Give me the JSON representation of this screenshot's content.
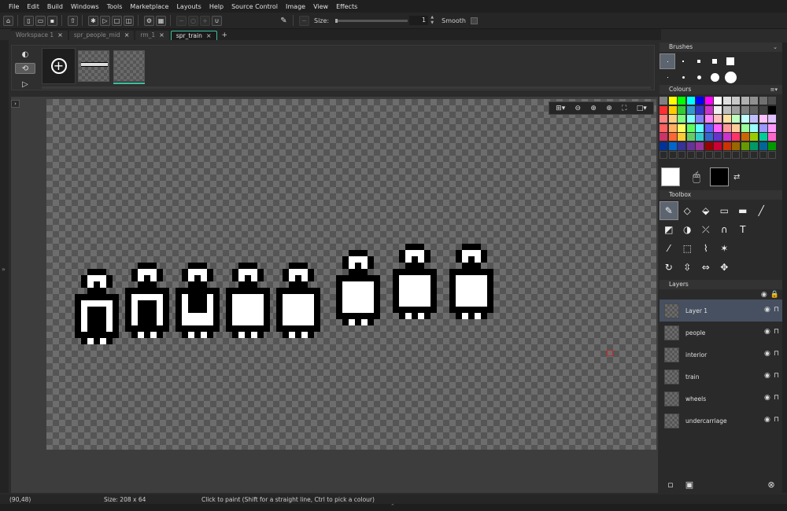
{
  "menu": [
    "File",
    "Edit",
    "Build",
    "Windows",
    "Tools",
    "Marketplace",
    "Layouts",
    "Help",
    "Source Control",
    "Image",
    "View",
    "Effects"
  ],
  "toolbar": {
    "size_label": "Size:",
    "size_value": "1",
    "size_fraction": 0.0,
    "smooth_label": "Smooth",
    "smooth_checked": false
  },
  "tabs": [
    {
      "label": "Workspace 1",
      "active": false
    },
    {
      "label": "spr_people_mid",
      "active": false
    },
    {
      "label": "rm_1",
      "active": false
    },
    {
      "label": "spr_train",
      "active": true
    }
  ],
  "frames": {
    "count": 2,
    "selected_index": 1
  },
  "panels": {
    "brushes_title": "Brushes",
    "colours_title": "Colours",
    "toolbox_title": "Toolbox",
    "layers_title": "Layers"
  },
  "palette_colors": [
    "#808080",
    "#ffff00",
    "#00ff00",
    "#00ffff",
    "#0000ff",
    "#ff00ff",
    "#ffffff",
    "#e0e0e0",
    "#c8c8c8",
    "#b0b0b0",
    "#909090",
    "#707070",
    "#505050",
    "#ff3030",
    "#ffcc00",
    "#33cc33",
    "#3399cc",
    "#3333cc",
    "#cc33cc",
    "#f0f0f0",
    "#c0c0c0",
    "#a0a0a0",
    "#808080",
    "#606060",
    "#404040",
    "#000000",
    "#ff8080",
    "#ffd080",
    "#80ff80",
    "#80ffff",
    "#8080ff",
    "#ff80ff",
    "#ffc0c0",
    "#ffe0a0",
    "#c0ffc0",
    "#c0ffff",
    "#c0c0ff",
    "#ffc0ff",
    "#e0c0ff",
    "#ff6060",
    "#ffb060",
    "#ffff60",
    "#60ff60",
    "#60ffff",
    "#6060ff",
    "#ff60ff",
    "#ff9999",
    "#ffcc99",
    "#99ff99",
    "#99ffff",
    "#9999ff",
    "#ff99ff",
    "#cc3366",
    "#ff6633",
    "#ffcc33",
    "#66cc66",
    "#33cccc",
    "#3366cc",
    "#6633cc",
    "#cc33cc",
    "#ff3366",
    "#cc6600",
    "#99cc00",
    "#00cc99",
    "#ff66cc",
    "#003399",
    "#0066cc",
    "#333399",
    "#663399",
    "#993399",
    "#990000",
    "#cc0033",
    "#cc3300",
    "#996600",
    "#669900",
    "#009966",
    "#006699",
    "#009900"
  ],
  "colors": {
    "primary": "#ffffff",
    "secondary": "#000000",
    "accent": "#3ac0a0"
  },
  "layers": [
    {
      "name": "Layer 1",
      "selected": true
    },
    {
      "name": "people",
      "selected": false
    },
    {
      "name": "interior",
      "selected": false
    },
    {
      "name": "train",
      "selected": false
    },
    {
      "name": "wheels",
      "selected": false
    },
    {
      "name": "undercarriage",
      "selected": false
    }
  ],
  "status": {
    "coords": "(90,48)",
    "size": "Size: 208 x 64",
    "hint": "Click to paint (Shift for a straight line, Ctrl to pick a colour)"
  }
}
